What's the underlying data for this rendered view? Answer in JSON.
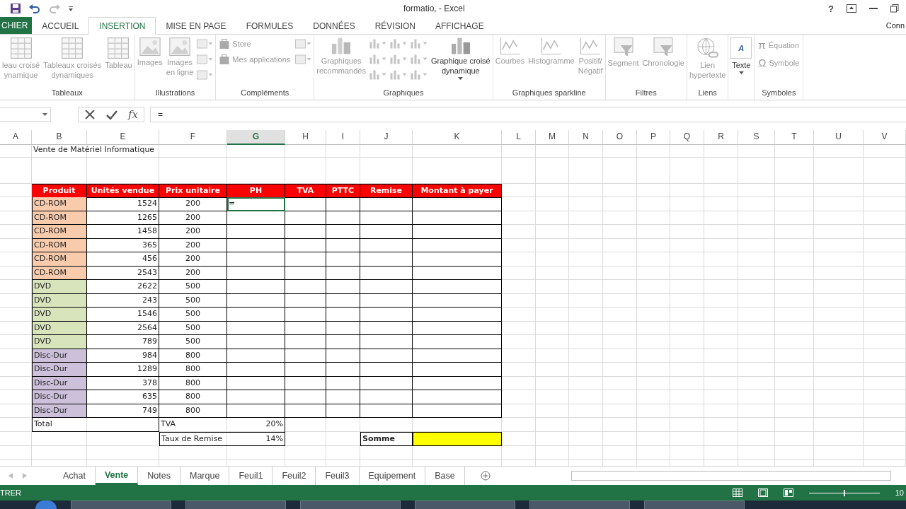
{
  "window": {
    "title": "formatio, - Excel",
    "help": "?",
    "account": "Conn"
  },
  "tabs": [
    {
      "label": "CHIER",
      "selected": false,
      "kind": "file"
    },
    {
      "label": "ACCUEIL",
      "selected": false,
      "kind": "tab"
    },
    {
      "label": "INSERTION",
      "selected": true,
      "kind": "tab"
    },
    {
      "label": "MISE EN PAGE",
      "selected": false,
      "kind": "tab"
    },
    {
      "label": "FORMULES",
      "selected": false,
      "kind": "tab"
    },
    {
      "label": "DONNÉES",
      "selected": false,
      "kind": "tab"
    },
    {
      "label": "RÉVISION",
      "selected": false,
      "kind": "tab"
    },
    {
      "label": "AFFICHAGE",
      "selected": false,
      "kind": "tab"
    }
  ],
  "ribbon": [
    {
      "label": "Tableaux",
      "columns": [
        [
          {
            "kind": "large",
            "lines": [
              "leau croisé",
              "ynamique"
            ],
            "disabled": true
          }
        ],
        [
          {
            "kind": "large",
            "lines": [
              "Tableaux croisés",
              "dynamiques"
            ],
            "disabled": true
          }
        ],
        [
          {
            "kind": "large",
            "lines": [
              "Tableau"
            ],
            "disabled": true
          }
        ]
      ]
    },
    {
      "label": "Illustrations",
      "columns": [
        [
          {
            "kind": "large",
            "lines": [
              "Images"
            ],
            "disabled": true
          }
        ],
        [
          {
            "kind": "large",
            "lines": [
              "Images",
              "en ligne"
            ],
            "disabled": true
          }
        ],
        [
          {
            "kind": "icon",
            "disabled": true
          },
          {
            "kind": "icon",
            "disabled": true
          },
          {
            "kind": "icon",
            "disabled": true
          }
        ]
      ]
    },
    {
      "label": "Compléments",
      "columns": [
        [
          {
            "kind": "small",
            "lines": [
              "Store"
            ],
            "disabled": true
          },
          {
            "kind": "small",
            "lines": [
              "Mes applications"
            ],
            "disabled": true
          }
        ],
        [
          {
            "kind": "icon",
            "disabled": true
          },
          {
            "kind": "icon",
            "disabled": true
          }
        ]
      ]
    },
    {
      "label": "Graphiques",
      "columns": [
        [
          {
            "kind": "large",
            "lines": [
              "Graphiques",
              "recommandés"
            ],
            "disabled": true
          }
        ],
        [
          {
            "kind": "icon",
            "disabled": true
          },
          {
            "kind": "icon",
            "disabled": true
          },
          {
            "kind": "icon",
            "disabled": true
          }
        ],
        [
          {
            "kind": "icon",
            "disabled": true
          },
          {
            "kind": "icon",
            "disabled": true
          },
          {
            "kind": "icon",
            "disabled": true
          }
        ],
        [
          {
            "kind": "icon",
            "disabled": true
          },
          {
            "kind": "icon",
            "disabled": true
          },
          {
            "kind": "icon",
            "disabled": true
          }
        ],
        [
          {
            "kind": "large",
            "lines": [
              "Graphique croisé",
              "dynamique"
            ],
            "disabled": false,
            "caret": true
          }
        ]
      ]
    },
    {
      "label": "Graphiques sparkline",
      "columns": [
        [
          {
            "kind": "large",
            "lines": [
              "Courbes"
            ],
            "disabled": true
          }
        ],
        [
          {
            "kind": "large",
            "lines": [
              "Histogramme"
            ],
            "disabled": true
          }
        ],
        [
          {
            "kind": "large",
            "lines": [
              "Positif/",
              "Négatif"
            ],
            "disabled": true
          }
        ]
      ]
    },
    {
      "label": "Filtres",
      "columns": [
        [
          {
            "kind": "large",
            "lines": [
              "Segment"
            ],
            "disabled": true
          }
        ],
        [
          {
            "kind": "large",
            "lines": [
              "Chronologie"
            ],
            "disabled": true
          }
        ]
      ]
    },
    {
      "label": "Liens",
      "columns": [
        [
          {
            "kind": "large",
            "lines": [
              "Lien",
              "hypertexte"
            ],
            "disabled": true
          }
        ]
      ]
    },
    {
      "columns": [
        [
          {
            "kind": "large",
            "lines": [
              "Texte"
            ],
            "disabled": false,
            "caret": true,
            "glyph": "A"
          }
        ]
      ]
    },
    {
      "label": "Symboles",
      "columns": [
        [
          {
            "kind": "small",
            "lines": [
              "Équation"
            ],
            "disabled": true,
            "glyph": "π"
          },
          {
            "kind": "small",
            "lines": [
              "Symbole"
            ],
            "disabled": true,
            "glyph": "Ω"
          }
        ]
      ]
    }
  ],
  "formula_bar": {
    "fx": "fx",
    "value": "="
  },
  "sheet": {
    "columns": [
      {
        "label": "A",
        "selected": false
      },
      {
        "label": "B",
        "selected": false
      },
      {
        "label": "E",
        "selected": false
      },
      {
        "label": "F",
        "selected": false
      },
      {
        "label": "G",
        "selected": true
      },
      {
        "label": "H",
        "selected": false
      },
      {
        "label": "I",
        "selected": false
      },
      {
        "label": "J",
        "selected": false
      },
      {
        "label": "K",
        "selected": false
      },
      {
        "label": "L",
        "selected": false
      },
      {
        "label": "M",
        "selected": false
      },
      {
        "label": "N",
        "selected": false
      },
      {
        "label": "O",
        "selected": false
      },
      {
        "label": "P",
        "selected": false
      },
      {
        "label": "Q",
        "selected": false
      },
      {
        "label": "R",
        "selected": false
      },
      {
        "label": "S",
        "selected": false
      },
      {
        "label": "T",
        "selected": false
      },
      {
        "label": "U",
        "selected": false
      },
      {
        "label": "V",
        "selected": false
      }
    ],
    "title": "Vente de Matériel Informatique",
    "headers": [
      "Produit",
      "Unités vendue",
      "Prix unitaire",
      "PH",
      "TVA",
      "PTTC",
      "Remise",
      "Montant à payer"
    ],
    "active_cell": "=",
    "rows": [
      {
        "product": "CD-ROM",
        "color": "#f8cbad",
        "units": "1524",
        "price": "200"
      },
      {
        "product": "CD-ROM",
        "color": "#f8cbad",
        "units": "1265",
        "price": "200"
      },
      {
        "product": "CD-ROM",
        "color": "#f8cbad",
        "units": "1458",
        "price": "200"
      },
      {
        "product": "CD-ROM",
        "color": "#f8cbad",
        "units": "365",
        "price": "200"
      },
      {
        "product": "CD-ROM",
        "color": "#f8cbad",
        "units": "456",
        "price": "200"
      },
      {
        "product": "CD-ROM",
        "color": "#f8cbad",
        "units": "2543",
        "price": "200"
      },
      {
        "product": "DVD",
        "color": "#d8e4bc",
        "units": "2622",
        "price": "500"
      },
      {
        "product": "DVD",
        "color": "#d8e4bc",
        "units": "243",
        "price": "500"
      },
      {
        "product": "DVD",
        "color": "#d8e4bc",
        "units": "1546",
        "price": "500"
      },
      {
        "product": "DVD",
        "color": "#d8e4bc",
        "units": "2564",
        "price": "500"
      },
      {
        "product": "DVD",
        "color": "#d8e4bc",
        "units": "789",
        "price": "500"
      },
      {
        "product": "Disc-Dur",
        "color": "#ccc0da",
        "units": "984",
        "price": "800"
      },
      {
        "product": "Disc-Dur",
        "color": "#ccc0da",
        "units": "1289",
        "price": "800"
      },
      {
        "product": "Disc-Dur",
        "color": "#ccc0da",
        "units": "378",
        "price": "800"
      },
      {
        "product": "Disc-Dur",
        "color": "#ccc0da",
        "units": "635",
        "price": "800"
      },
      {
        "product": "Disc-Dur",
        "color": "#ccc0da",
        "units": "749",
        "price": "800"
      }
    ],
    "total_label": "Total",
    "tva": {
      "label": "TVA",
      "value": "20%"
    },
    "remise": {
      "label": "Taux de Remise",
      "value": "14%"
    },
    "somme": {
      "label": "Somme",
      "color": "#ffff00"
    }
  },
  "sheet_tabs": [
    {
      "label": "Achat",
      "selected": false
    },
    {
      "label": "Vente",
      "selected": true
    },
    {
      "label": "Notes",
      "selected": false
    },
    {
      "label": "Marque",
      "selected": false
    },
    {
      "label": "Feuil1",
      "selected": false
    },
    {
      "label": "Feuil2",
      "selected": false
    },
    {
      "label": "Feuil3",
      "selected": false
    },
    {
      "label": "Equipement",
      "selected": false
    },
    {
      "label": "Base",
      "selected": false
    }
  ],
  "status_bar": {
    "mode": "TRER",
    "zoom": {
      "level": 0.5,
      "reading": "10"
    }
  }
}
